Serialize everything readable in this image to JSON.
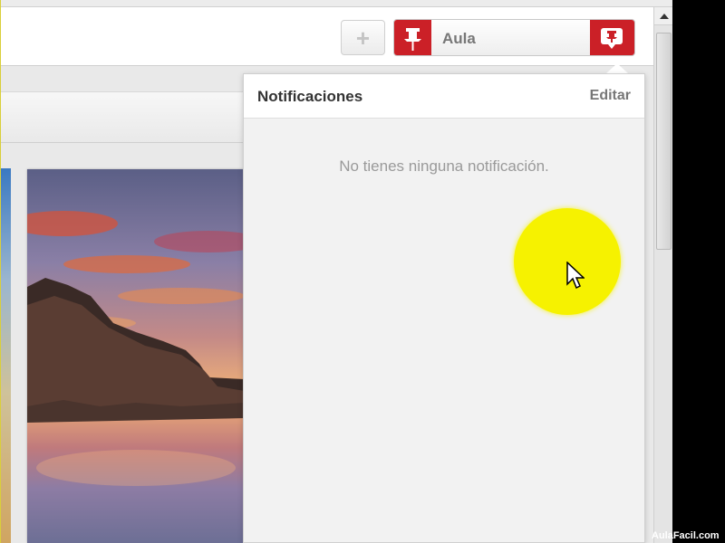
{
  "header": {
    "add_label": "+",
    "user_name": "Aula"
  },
  "notifications": {
    "title": "Notificaciones",
    "edit_label": "Editar",
    "empty_message": "No tienes ninguna notificación."
  },
  "watermark": "AulaFacil.com",
  "colors": {
    "brand_red": "#cb2027",
    "highlight_yellow": "#f6f200"
  },
  "icons": {
    "pin": "pushpin-icon",
    "notifications": "speech-bubble-pin-icon",
    "add": "plus-icon"
  }
}
